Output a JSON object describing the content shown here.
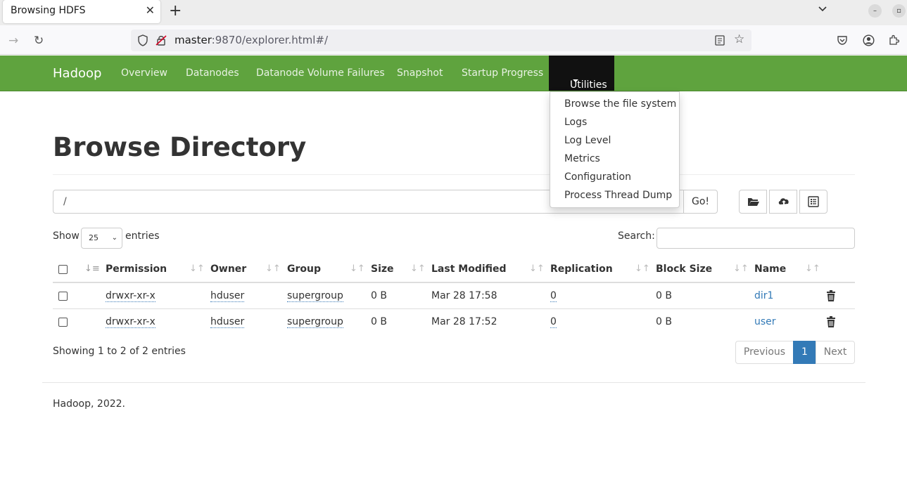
{
  "browser": {
    "tab_title": "Browsing HDFS",
    "url_host": "master",
    "url_rest": ":9870/explorer.html#/"
  },
  "navbar": {
    "brand": "Hadoop",
    "items": [
      "Overview",
      "Datanodes",
      "Datanode Volume Failures",
      "Snapshot",
      "Startup Progress"
    ],
    "utilities_label": "Utilities",
    "accent_color": "#5fa33e"
  },
  "utilities_menu": [
    "Browse the file system",
    "Logs",
    "Log Level",
    "Metrics",
    "Configuration",
    "Process Thread Dump"
  ],
  "page": {
    "title": "Browse Directory",
    "path_value": "/",
    "go_label": "Go!",
    "show_label": "Show",
    "entries_value": "25",
    "entries_label": "entries",
    "search_label": "Search:"
  },
  "table": {
    "headers": [
      "Permission",
      "Owner",
      "Group",
      "Size",
      "Last Modified",
      "Replication",
      "Block Size",
      "Name"
    ],
    "rows": [
      {
        "permission": "drwxr-xr-x",
        "owner": "hduser",
        "group": "supergroup",
        "size": "0 B",
        "modified": "Mar 28 17:58",
        "replication": "0",
        "block_size": "0 B",
        "name": "dir1"
      },
      {
        "permission": "drwxr-xr-x",
        "owner": "hduser",
        "group": "supergroup",
        "size": "0 B",
        "modified": "Mar 28 17:52",
        "replication": "0",
        "block_size": "0 B",
        "name": "user"
      }
    ]
  },
  "pagination": {
    "info": "Showing 1 to 2 of 2 entries",
    "previous": "Previous",
    "current": "1",
    "next": "Next"
  },
  "footer": "Hadoop, 2022."
}
